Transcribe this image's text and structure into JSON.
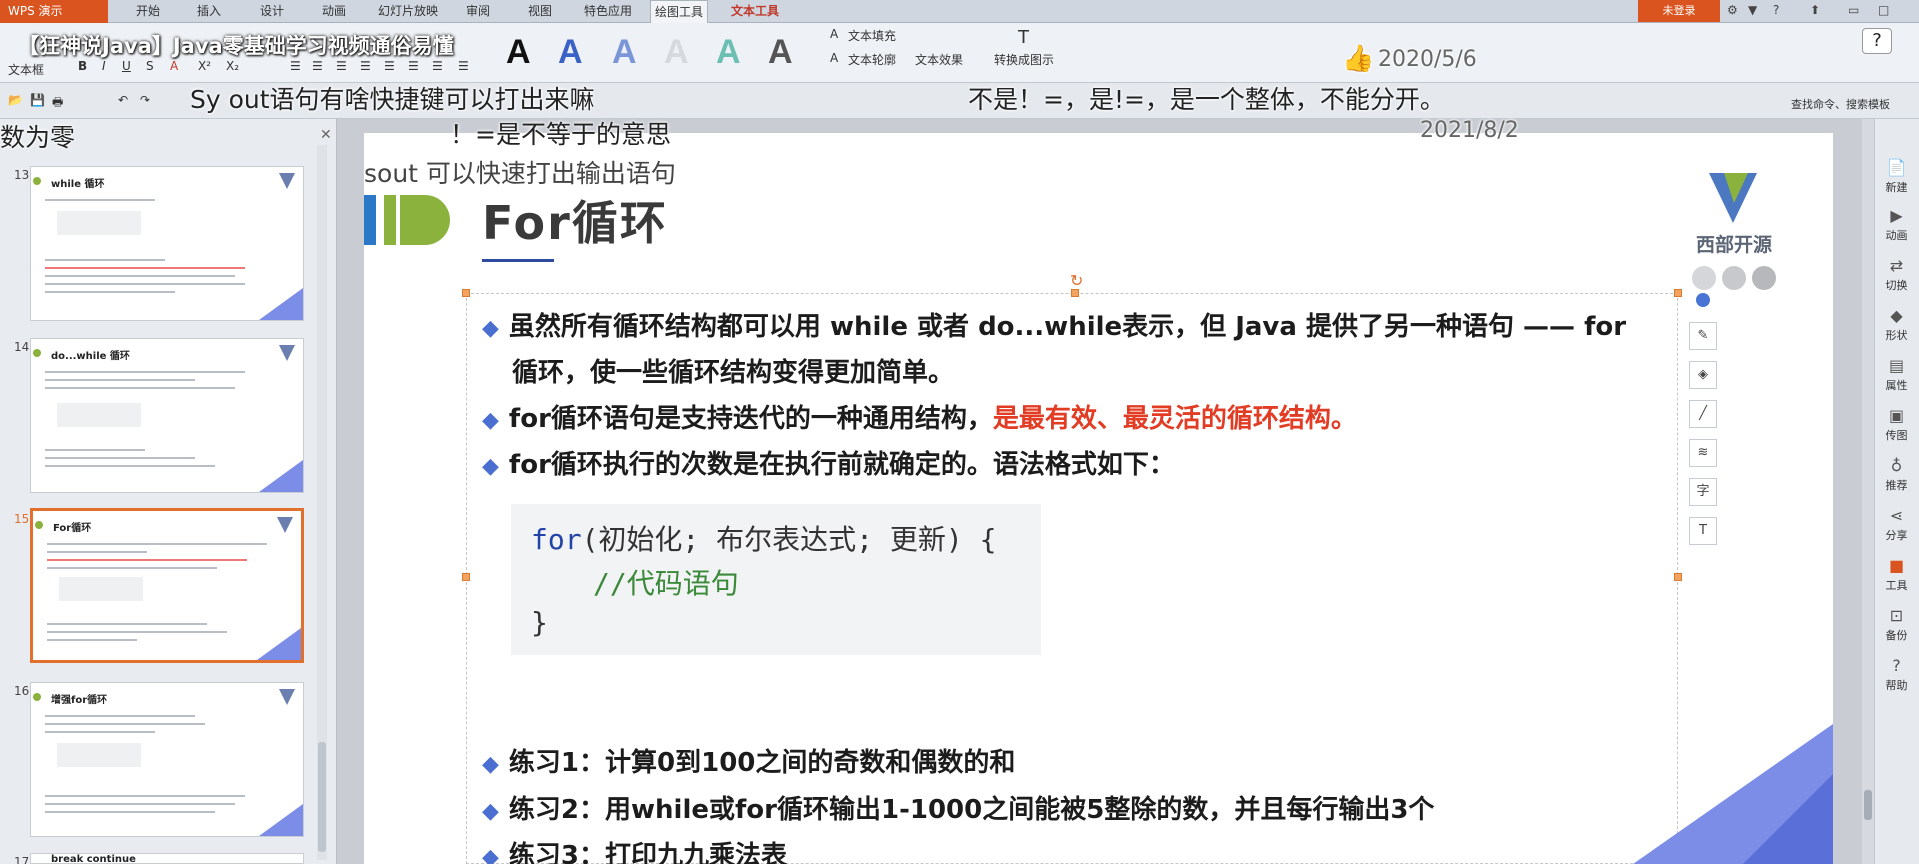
{
  "app": {
    "menu_label": "WPS 演示",
    "login": "未登录"
  },
  "tabs": [
    "开始",
    "插入",
    "设计",
    "动画",
    "幻灯片放映",
    "审阅",
    "视图",
    "特色应用",
    "绘图工具",
    "文本工具"
  ],
  "ribbon": {
    "textbox_label": "文本框",
    "text_fill": "文本填充",
    "text_outline": "文本轮廓",
    "text_effect": "文本效果",
    "convert_art": "转换成图示",
    "search": "查找命令、搜索模板"
  },
  "video": {
    "title": "【狂神说Java】Java零基础学习视频通俗易懂",
    "like_date": "2020/5/6",
    "date2": "2021/8/2",
    "danmaku": [
      "Sy    out语句有啥快捷键可以打出来嘛",
      "！=是不等于的意思",
      "sout  可以快速打出输出语句",
      "数为零",
      "不是！=，是!=，是一个整体，不能分开。"
    ]
  },
  "thumbnails": [
    {
      "num": "13",
      "title": "while 循环"
    },
    {
      "num": "14",
      "title": "do...while 循环"
    },
    {
      "num": "15",
      "title": "For循环"
    },
    {
      "num": "16",
      "title": "增强for循环"
    },
    {
      "num": "17",
      "title": "break continue"
    }
  ],
  "slide": {
    "title": "For循环",
    "logo_text": "西部开源",
    "bullets": [
      {
        "text": "虽然所有循环结构都可以用 while 或者 do...while表示，但 Java 提供了另一种语句 —— for"
      },
      {
        "text": "循环，使一些循环结构变得更加简单。"
      },
      {
        "text": "for循环语句是支持迭代的一种通用结构，",
        "red": "是最有效、最灵活的循环结构。"
      },
      {
        "text": "for循环执行的次数是在执行前就确定的。语法格式如下："
      }
    ],
    "code": {
      "kw": "for",
      "line1_rest": "(初始化; 布尔表达式; 更新) {",
      "line2": "//代码语句",
      "line3": "}"
    },
    "exercises": [
      "练习1：计算0到100之间的奇数和偶数的和",
      "练习2：用while或for循环输出1-1000之间能被5整除的数，并且每行输出3个",
      "练习3：打印九九乘法表"
    ]
  },
  "right_panel": [
    "新建",
    "动画",
    "切换",
    "形状",
    "属性",
    "传图",
    "推荐",
    "分享",
    "工具",
    "备份",
    "帮助"
  ]
}
